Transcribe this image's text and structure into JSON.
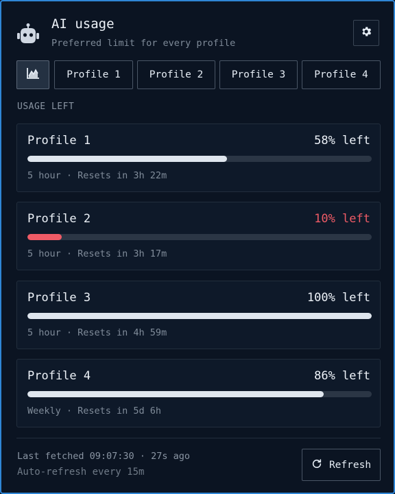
{
  "header": {
    "title": "AI usage",
    "subtitle": "Preferred limit for every profile",
    "logo_icon": "robot-icon",
    "settings_icon": "gear-icon"
  },
  "tabs": {
    "chart_icon": "chart-icon",
    "items": [
      {
        "label": "Profile 1"
      },
      {
        "label": "Profile 2"
      },
      {
        "label": "Profile 3"
      },
      {
        "label": "Profile 4"
      }
    ]
  },
  "section_label": "USAGE LEFT",
  "profiles": [
    {
      "name": "Profile 1",
      "percent_label": "58% left",
      "percent": 58,
      "meta": "5 hour · Resets in 3h 22m",
      "status": "normal"
    },
    {
      "name": "Profile 2",
      "percent_label": "10% left",
      "percent": 10,
      "meta": "5 hour · Resets in 3h 17m",
      "status": "low"
    },
    {
      "name": "Profile 3",
      "percent_label": "100% left",
      "percent": 100,
      "meta": "5 hour · Resets in 4h 59m",
      "status": "normal"
    },
    {
      "name": "Profile 4",
      "percent_label": "86% left",
      "percent": 86,
      "meta": "Weekly · Resets in 5d 6h",
      "status": "normal"
    }
  ],
  "footer": {
    "last_fetched": "Last fetched 09:07:30 · 27s ago",
    "auto_refresh": "Auto-refresh every 15m",
    "refresh_label": "Refresh",
    "refresh_icon": "refresh-icon"
  },
  "colors": {
    "accent_border": "#2f86d6",
    "low": "#ef5b66",
    "bar_fill": "#dfe6ee",
    "bar_track": "#2b3645"
  }
}
